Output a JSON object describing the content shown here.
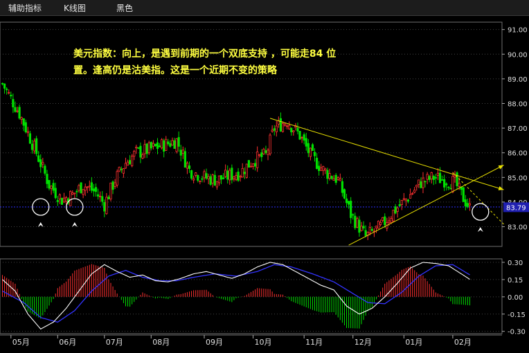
{
  "toolbar": {
    "tabs": [
      {
        "label": "辅助指标"
      },
      {
        "label": "K线图"
      },
      {
        "label": "黑色"
      }
    ]
  },
  "annotation": {
    "line1": "美元指数：向上，是遇到前期的一个双底支持 ，可能走84 位",
    "line2": "置。逢高仍是沽美指。这是一个近期不变的策略"
  },
  "colors": {
    "up": "#ff3030",
    "down": "#00e000",
    "trend": "#e8e000",
    "support": "#3030ff",
    "price_tag_bg": "#2020b0",
    "dif": "#ffffff",
    "dea": "#3333ff",
    "grid": "#444444"
  },
  "chart_data": {
    "type": "candlestick",
    "title": "",
    "price_axis": {
      "ticks": [
        "91.00",
        "90.00",
        "89.00",
        "88.00",
        "87.00",
        "86.00",
        "85.00",
        "84.00",
        "83.00"
      ],
      "ylim": [
        82.2,
        91.3
      ]
    },
    "current_price": {
      "label": "83.79",
      "value": 83.79
    },
    "support_level": 83.8,
    "x_axis": {
      "labels": [
        "05月",
        "06月",
        "07月",
        "08月",
        "09月",
        "10月",
        "11月",
        "12月",
        "01月",
        "02月"
      ]
    },
    "candles_count": 221,
    "price_path": [
      [
        0,
        88.8
      ],
      [
        8,
        87.6
      ],
      [
        16,
        86.0
      ],
      [
        22,
        84.7
      ],
      [
        28,
        84.1
      ],
      [
        33,
        84.3
      ],
      [
        38,
        84.7
      ],
      [
        44,
        84.4
      ],
      [
        48,
        83.9
      ],
      [
        53,
        84.9
      ],
      [
        58,
        85.6
      ],
      [
        63,
        86.0
      ],
      [
        68,
        86.1
      ],
      [
        75,
        86.3
      ],
      [
        82,
        86.5
      ],
      [
        88,
        85.3
      ],
      [
        95,
        85.0
      ],
      [
        101,
        84.9
      ],
      [
        108,
        85.1
      ],
      [
        112,
        85.2
      ],
      [
        118,
        85.7
      ],
      [
        124,
        85.9
      ],
      [
        128,
        87.0
      ],
      [
        134,
        87.3
      ],
      [
        140,
        86.7
      ],
      [
        145,
        85.9
      ],
      [
        151,
        85.3
      ],
      [
        158,
        84.9
      ],
      [
        164,
        83.5
      ],
      [
        171,
        82.6
      ],
      [
        178,
        83.0
      ],
      [
        184,
        83.6
      ],
      [
        191,
        84.2
      ],
      [
        197,
        84.8
      ],
      [
        203,
        85.0
      ],
      [
        208,
        84.9
      ],
      [
        213,
        84.8
      ],
      [
        216,
        84.3
      ],
      [
        219,
        83.9
      ],
      [
        221,
        83.6
      ]
    ],
    "trendlines": [
      {
        "name": "upper",
        "from": [
          126,
          87.4
        ],
        "to": [
          236,
          84.5
        ]
      },
      {
        "name": "lower",
        "from": [
          163,
          82.25
        ],
        "to": [
          236,
          85.5
        ]
      },
      {
        "name": "dash",
        "from": [
          212,
          85.2
        ],
        "to": [
          236,
          83.1
        ]
      }
    ],
    "markers": [
      {
        "x": 18,
        "price": 83.8
      },
      {
        "x": 34,
        "price": 83.8
      },
      {
        "x": 225,
        "price": 83.6
      }
    ],
    "indicator": {
      "type": "macd",
      "ticks": [
        "0.30",
        "0.15",
        "0.00",
        "-0.15",
        "-0.30"
      ],
      "ylim": [
        -0.32,
        0.33
      ],
      "dif_path": [
        [
          0,
          0.15
        ],
        [
          6,
          0.05
        ],
        [
          12,
          -0.15
        ],
        [
          18,
          -0.28
        ],
        [
          24,
          -0.22
        ],
        [
          30,
          -0.1
        ],
        [
          36,
          0.05
        ],
        [
          42,
          0.2
        ],
        [
          48,
          0.28
        ],
        [
          54,
          0.22
        ],
        [
          60,
          0.17
        ],
        [
          66,
          0.19
        ],
        [
          72,
          0.14
        ],
        [
          78,
          0.13
        ],
        [
          84,
          0.16
        ],
        [
          90,
          0.2
        ],
        [
          96,
          0.22
        ],
        [
          102,
          0.19
        ],
        [
          108,
          0.16
        ],
        [
          114,
          0.2
        ],
        [
          120,
          0.26
        ],
        [
          126,
          0.3
        ],
        [
          132,
          0.28
        ],
        [
          138,
          0.22
        ],
        [
          144,
          0.16
        ],
        [
          150,
          0.1
        ],
        [
          156,
          0.06
        ],
        [
          162,
          -0.08
        ],
        [
          168,
          -0.15
        ],
        [
          174,
          -0.1
        ],
        [
          180,
          0.0
        ],
        [
          186,
          0.12
        ],
        [
          192,
          0.25
        ],
        [
          198,
          0.3
        ],
        [
          204,
          0.29
        ],
        [
          210,
          0.27
        ],
        [
          216,
          0.2
        ],
        [
          221,
          0.14
        ]
      ],
      "dea_path": [
        [
          0,
          0.05
        ],
        [
          10,
          -0.05
        ],
        [
          18,
          -0.18
        ],
        [
          26,
          -0.22
        ],
        [
          34,
          -0.12
        ],
        [
          42,
          0.05
        ],
        [
          50,
          0.18
        ],
        [
          58,
          0.23
        ],
        [
          66,
          0.17
        ],
        [
          74,
          0.14
        ],
        [
          82,
          0.14
        ],
        [
          90,
          0.17
        ],
        [
          100,
          0.2
        ],
        [
          110,
          0.18
        ],
        [
          120,
          0.22
        ],
        [
          128,
          0.28
        ],
        [
          136,
          0.26
        ],
        [
          146,
          0.2
        ],
        [
          156,
          0.13
        ],
        [
          164,
          0.04
        ],
        [
          172,
          -0.05
        ],
        [
          180,
          -0.06
        ],
        [
          188,
          0.04
        ],
        [
          196,
          0.18
        ],
        [
          204,
          0.27
        ],
        [
          212,
          0.28
        ],
        [
          221,
          0.18
        ]
      ]
    }
  }
}
